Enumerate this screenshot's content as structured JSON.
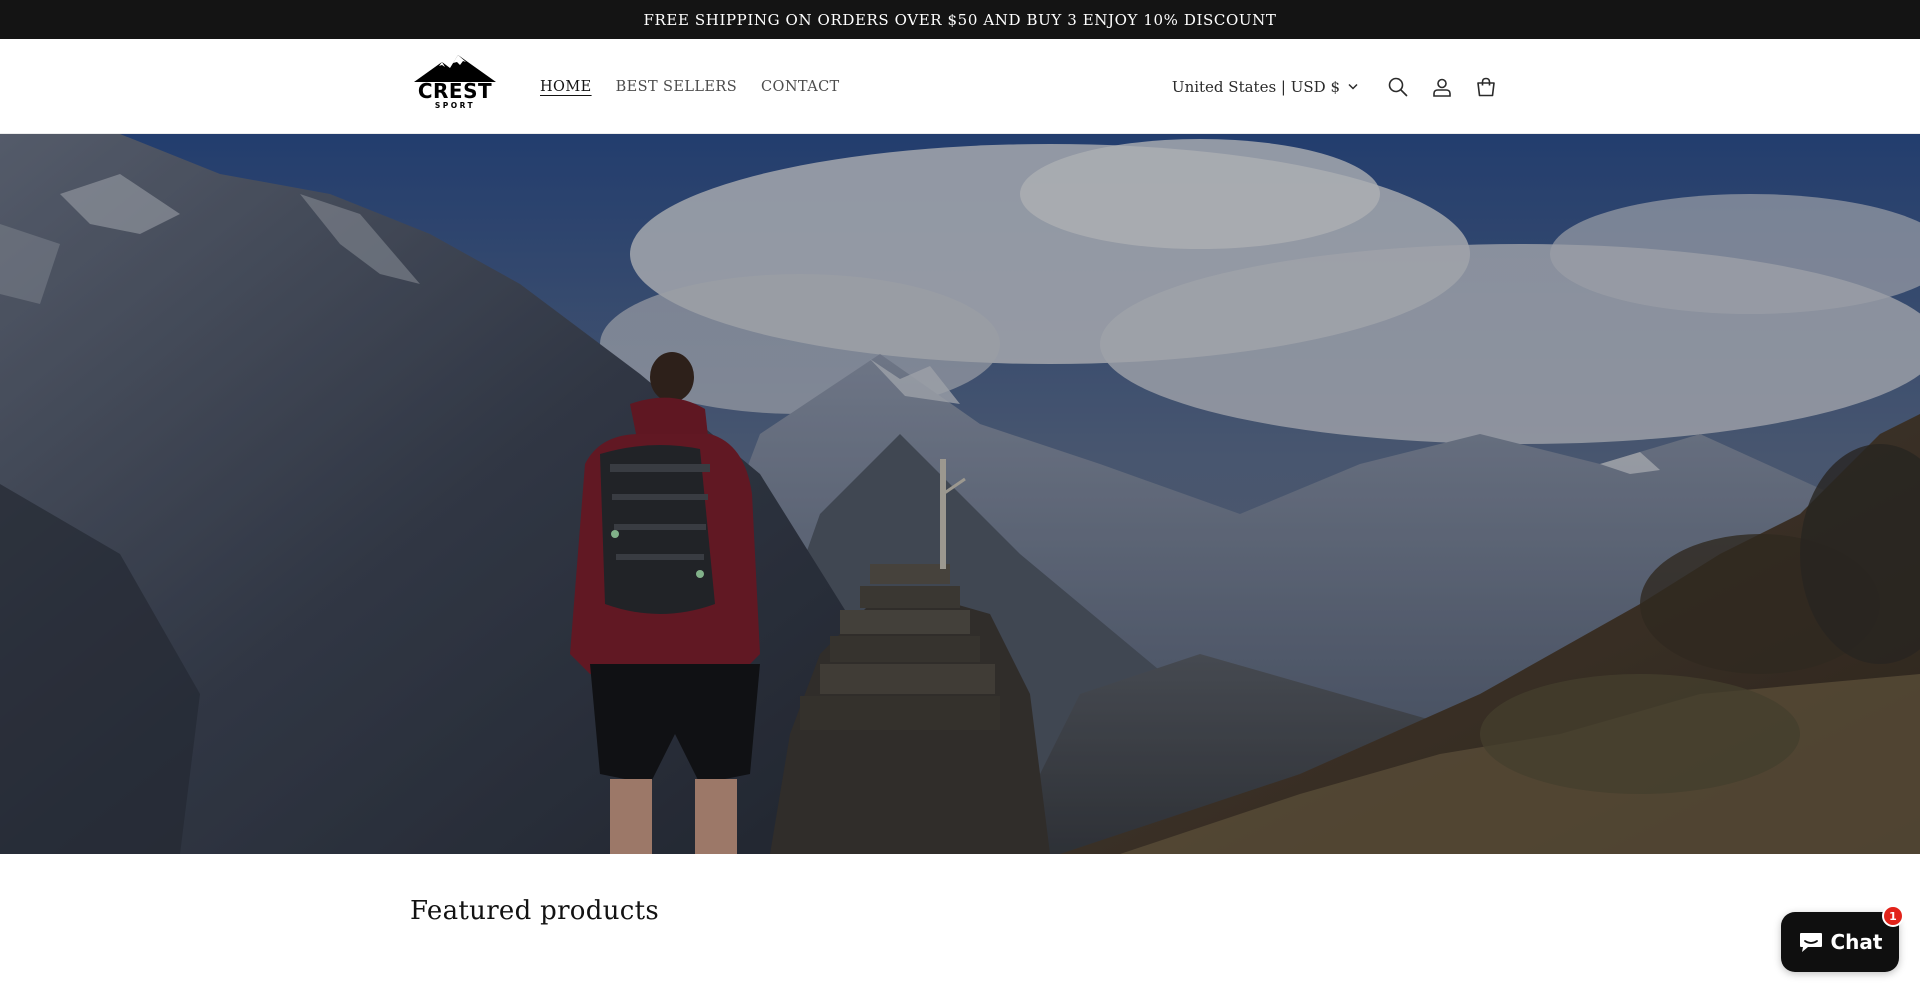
{
  "announcement": {
    "text": "FREE SHIPPING ON ORDERS OVER $50 AND BUY 3 ENJOY 10% DISCOUNT"
  },
  "header": {
    "logo": {
      "word": "CREST",
      "sub": "SPORT"
    },
    "nav": [
      {
        "label": "HOME",
        "active": true
      },
      {
        "label": "BEST SELLERS",
        "active": false
      },
      {
        "label": "CONTACT",
        "active": false
      }
    ],
    "locale": "United States | USD $",
    "icons": [
      "search-icon",
      "account-icon",
      "cart-icon",
      "chevron-down-icon"
    ]
  },
  "hero": {
    "image": "hiker-mountain-landscape"
  },
  "featured": {
    "title": "Featured products"
  },
  "chat": {
    "label": "Chat",
    "badge": "1",
    "icon": "chat-bubble-icon"
  },
  "colors": {
    "announcement_bg": "#141414",
    "chat_bg": "#0f0f0f",
    "badge_red": "#e2231a",
    "text": "#121212"
  }
}
